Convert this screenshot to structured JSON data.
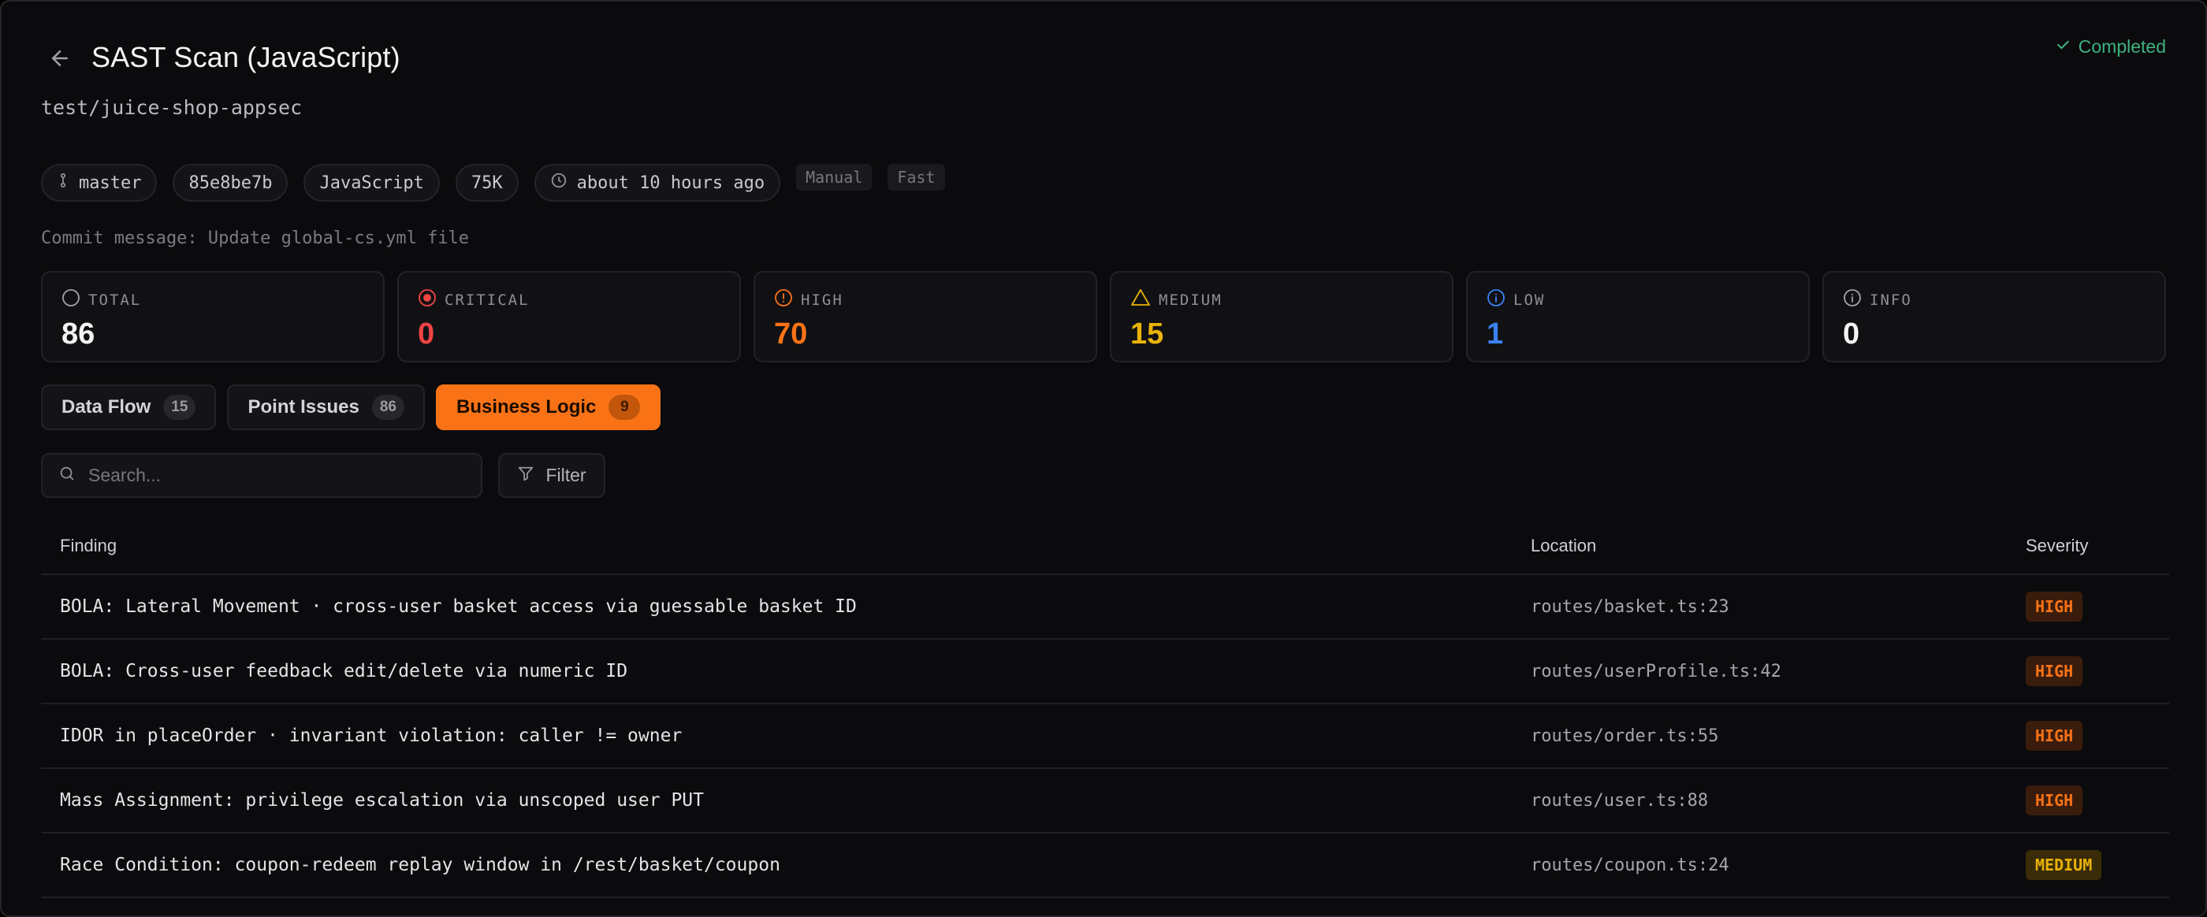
{
  "header": {
    "title": "SAST Scan (JavaScript)",
    "repo": "test/juice-shop-appsec",
    "status": "Completed"
  },
  "meta": {
    "branch": "master",
    "commit": "85e8be7b",
    "language": "JavaScript",
    "lines": "75K",
    "time": "about 10 hours ago",
    "tags": [
      "Manual",
      "Fast"
    ]
  },
  "commit_message": "Commit message: Update global-cs.yml file",
  "stats": [
    {
      "label": "TOTAL",
      "value": "86",
      "color": "#f4f4f5",
      "icon": "circle-icon"
    },
    {
      "label": "CRITICAL",
      "value": "0",
      "color": "#ef4444",
      "icon": "target-icon"
    },
    {
      "label": "HIGH",
      "value": "70",
      "color": "#f97316",
      "icon": "alert-circle-icon"
    },
    {
      "label": "MEDIUM",
      "value": "15",
      "color": "#eab308",
      "icon": "warning-triangle-icon"
    },
    {
      "label": "LOW",
      "value": "1",
      "color": "#3b82f6",
      "icon": "info-circle-icon"
    },
    {
      "label": "INFO",
      "value": "0",
      "color": "#f4f4f5",
      "icon": "info-circle-icon"
    }
  ],
  "tabs": [
    {
      "label": "Data Flow",
      "count": "15",
      "active": false
    },
    {
      "label": "Point Issues",
      "count": "86",
      "active": false
    },
    {
      "label": "Business Logic",
      "count": "9",
      "active": true
    }
  ],
  "search": {
    "placeholder": "Search..."
  },
  "filter_label": "Filter",
  "table": {
    "headers": {
      "finding": "Finding",
      "location": "Location",
      "severity": "Severity"
    },
    "rows": [
      {
        "finding": "BOLA: Lateral Movement · cross-user basket access via guessable basket ID",
        "location": "routes/basket.ts:23",
        "severity": "HIGH"
      },
      {
        "finding": "BOLA: Cross-user feedback edit/delete via numeric ID",
        "location": "routes/userProfile.ts:42",
        "severity": "HIGH"
      },
      {
        "finding": "IDOR in placeOrder · invariant violation: caller != owner",
        "location": "routes/order.ts:55",
        "severity": "HIGH"
      },
      {
        "finding": "Mass Assignment: privilege escalation via unscoped user PUT",
        "location": "routes/user.ts:88",
        "severity": "HIGH"
      },
      {
        "finding": "Race Condition: coupon-redeem replay window in /rest/basket/coupon",
        "location": "routes/coupon.ts:24",
        "severity": "MEDIUM"
      }
    ]
  }
}
